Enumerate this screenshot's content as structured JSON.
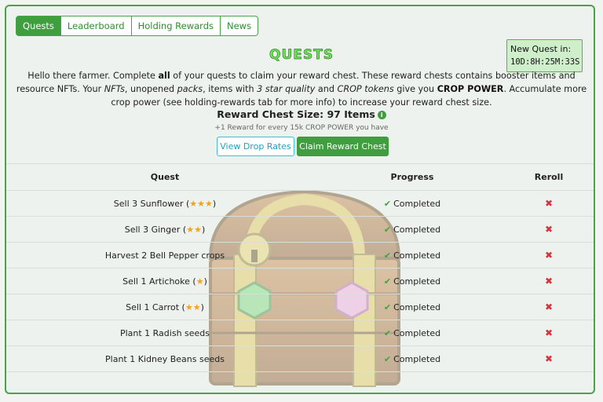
{
  "tabs": [
    {
      "label": "Quests",
      "active": true
    },
    {
      "label": "Leaderboard",
      "active": false
    },
    {
      "label": "Holding Rewards",
      "active": false
    },
    {
      "label": "News",
      "active": false
    }
  ],
  "new_quest": {
    "label": "New Quest in:",
    "timer": "10D:8H:25M:33S"
  },
  "title": "QUESTS",
  "intro": {
    "p1": "Hello there farmer. Complete ",
    "p1_bold": "all",
    "p2": " of your quests to claim your reward chest. These reward chests contains booster items and resource NFTs. Your ",
    "nfts": "NFTs",
    "p3": ", unopened ",
    "packs": "packs",
    "p4": ", items with ",
    "star_quality": "3 star quality",
    "p5": " and ",
    "crop_tokens": "CROP tokens",
    "p6": " give you ",
    "crop_power": "CROP POWER",
    "p7": ". Accumulate more crop power (see holding-rewards tab for more info) to increase your reward chest size."
  },
  "chest_size": "Reward Chest Size: 97 Items",
  "chest_note": "+1 Reward for every 15k CROP POWER you have",
  "buttons": {
    "view": "View Drop Rates",
    "claim": "Claim Reward Chest"
  },
  "table": {
    "headers": {
      "quest": "Quest",
      "progress": "Progress",
      "reroll": "Reroll"
    },
    "rows": [
      {
        "quest": "Sell 3 Sunflower",
        "stars": 3,
        "progress": "Completed"
      },
      {
        "quest": "Sell 3 Ginger",
        "stars": 2,
        "progress": "Completed"
      },
      {
        "quest": "Harvest 2 Bell Pepper crops",
        "stars": 0,
        "progress": "Completed"
      },
      {
        "quest": "Sell 1 Artichoke",
        "stars": 1,
        "progress": "Completed"
      },
      {
        "quest": "Sell 1 Carrot",
        "stars": 2,
        "progress": "Completed"
      },
      {
        "quest": "Plant 1 Radish seeds",
        "stars": 0,
        "progress": "Completed"
      },
      {
        "quest": "Plant 1 Kidney Beans seeds",
        "stars": 0,
        "progress": "Completed"
      }
    ]
  },
  "icons": {
    "check": "check-icon",
    "reroll": "x-icon",
    "star": "star-icon",
    "info": "info-icon"
  },
  "colors": {
    "accent": "#3f9f3f",
    "title": "#6ee35a",
    "reroll": "#d8333a",
    "star": "#f4a11b"
  }
}
